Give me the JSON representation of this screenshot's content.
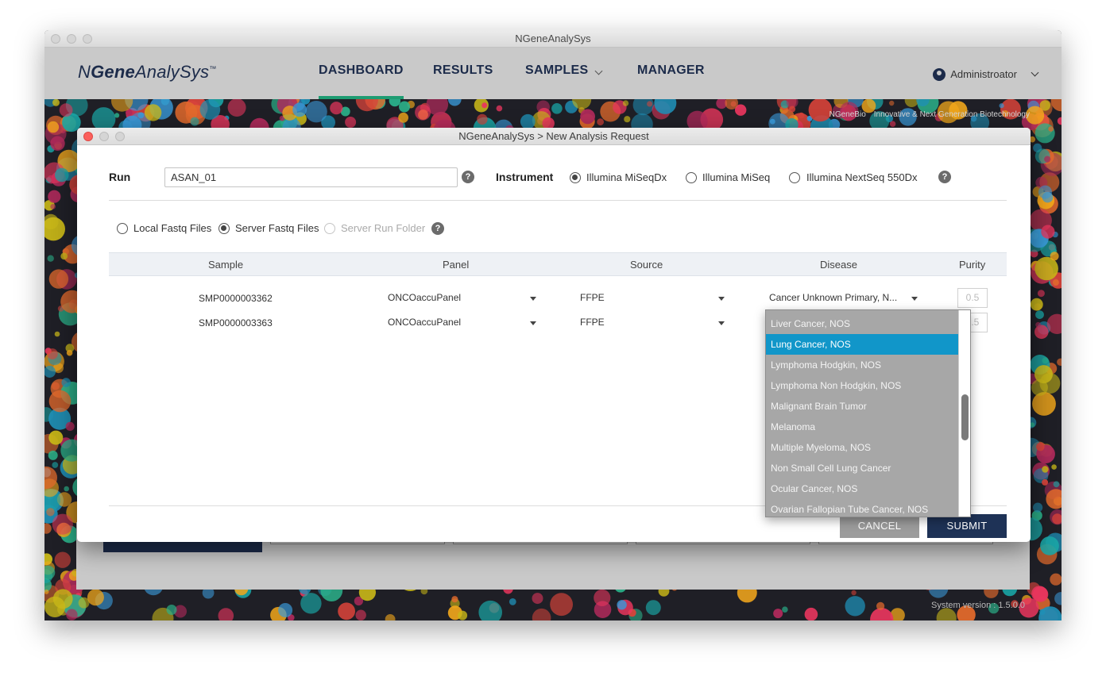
{
  "app": {
    "window_title": "NGeneAnalySys",
    "logo_prefix": "N",
    "logo_bold": "Gene",
    "logo_suffix": "AnalySys",
    "logo_tm": "™",
    "nav": {
      "dashboard": "DASHBOARD",
      "results": "RESULTS",
      "samples": "SAMPLES",
      "manager": "MANAGER"
    },
    "user": "Administroator",
    "tagline_company": "NGeneBio",
    "tagline_text": "Innovative & Next Generation Biotechnology",
    "version": "System version : 1.5.0.0"
  },
  "modal": {
    "title": "NGeneAnalySys > New Analysis Request",
    "run_label": "Run",
    "run_value": "ASAN_01",
    "instrument_label": "Instrument",
    "help_glyph": "?",
    "instruments": [
      "Illumina MiSeqDx",
      "Illumina MiSeq",
      "Illumina NextSeq 550Dx"
    ],
    "instrument_selected": "Illumina MiSeqDx",
    "sources": [
      "Local Fastq Files",
      "Server Fastq Files",
      "Server Run Folder"
    ],
    "source_selected": "Server Fastq Files",
    "columns": [
      "Sample",
      "Panel",
      "Source",
      "Disease",
      "Purity"
    ],
    "rows": [
      {
        "sample": "SMP0000003362",
        "panel": "ONCOaccuPanel",
        "source": "FFPE",
        "disease": "Cancer Unknown Primary, N...",
        "purity": "0.5"
      },
      {
        "sample": "SMP0000003363",
        "panel": "ONCOaccuPanel",
        "source": "FFPE",
        "disease": "",
        "purity": "0.5"
      }
    ],
    "cancel": "CANCEL",
    "submit": "SUBMIT"
  },
  "disease_dropdown": {
    "items": [
      "Liver Cancer, NOS",
      "Lung Cancer, NOS",
      "Lymphoma Hodgkin, NOS",
      "Lymphoma Non Hodgkin, NOS",
      "Malignant Brain Tumor",
      "Melanoma",
      "Multiple Myeloma, NOS",
      "Non Small Cell Lung Cancer",
      "Ocular Cancer, NOS",
      "Ovarian Fallopian Tube Cancer, NOS"
    ],
    "selected": "Lung Cancer, NOS"
  },
  "colors": {
    "accent_green": "#1e9c72",
    "navy": "#1c2b4a",
    "selected_blue": "#1196c9"
  }
}
